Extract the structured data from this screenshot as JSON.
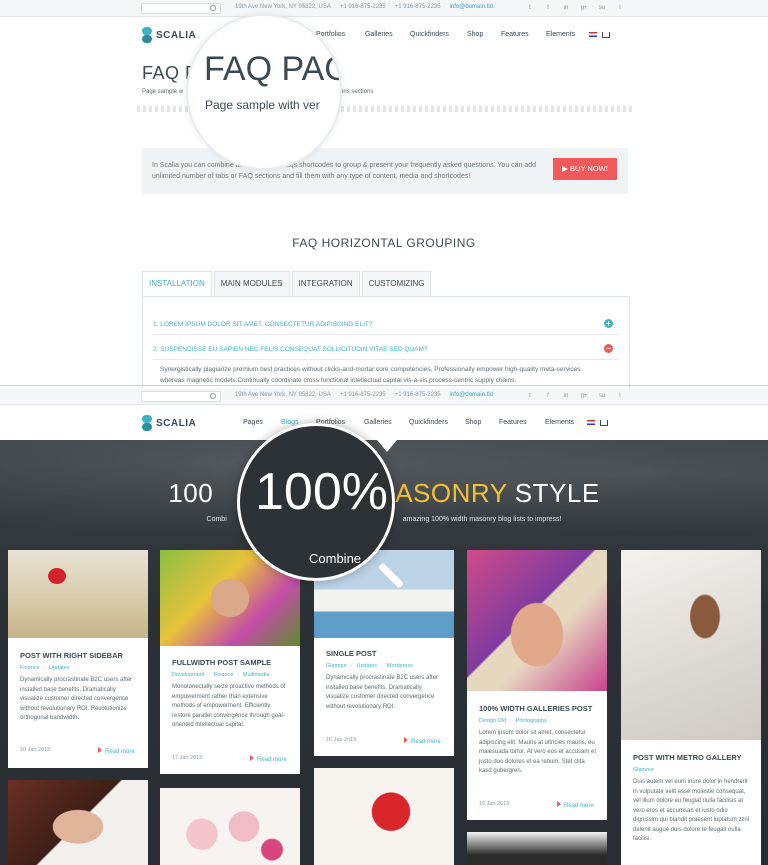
{
  "top_bar": {
    "address": "19th Ave New York, NY 95822, USA",
    "phone1": "+1 916-875-2235",
    "phone2": "+1 916-875-2235",
    "email": "info@domain.tld"
  },
  "brand": {
    "logo_text": "SCALIA"
  },
  "menu_top": [
    "Portfolios",
    "Galleries",
    "Quickfinders",
    "Shop",
    "Features",
    "Elements"
  ],
  "menu_bottom": [
    "Pages",
    "Blogs",
    "Portfolios",
    "Galleries",
    "Quickfinders",
    "Shop",
    "Features",
    "Elements"
  ],
  "faq": {
    "title": "FAQ P",
    "subtitle_left": "Page sample w",
    "subtitle_right": "ked questions sections",
    "cta_text": "In Scalia you can combine tabs, toggles & faqs shortcodes to group & present your frequently asked questions. You can add unlimited number of tabs or FAQ sections and fill them with any type of content, media and shortcodes!",
    "buy_label": "BUY NOW!",
    "section_heading": "FAQ HORIZONTAL GROUPING",
    "tabs": [
      "INSTALLATION",
      "MAIN MODULES",
      "INTEGRATION",
      "CUSTOMIZING"
    ],
    "questions": [
      {
        "label": "1. LOREM IPSUM DOLOR SIT AMET, CONSECTETUR ADIPISCING ELIT?",
        "state": "+",
        "color": "#3fb2c3"
      },
      {
        "label": "2. SUSPENDISSE EU SAPIEN NEC FELIS CONSEQUAT SOLLICITUDIN VITAE SED QUAM?",
        "state": "−",
        "color": "#f05a5a"
      }
    ],
    "answer": "Synergistically plagiarize premium best practices without clicks-and-mortar core competencies. Professionally empower high-quality meta-services whereas magnetic models.Continually coordinate cross functional intellectual capital vis-a-vis process-centric supply chains.",
    "magnifier_big": "FAQ PAG",
    "magnifier_small": "Page sample with ver"
  },
  "blog": {
    "hero_title_pre": "100",
    "hero_title_mid": "ASONRY",
    "hero_title_post": " STYLE",
    "hero_sub_left": "Combi",
    "hero_sub_right": "amazing 100% width masonry blog lists to impress!",
    "magnifier_big": "100%",
    "magnifier_small": "Combine",
    "posts": [
      {
        "title": "POST WITH RIGHT SIDEBAR",
        "tags": [
          "Finance",
          "Updates"
        ],
        "body": "Dynamically procrastinate B2C users after installed base benefits. Dramatically visualize customer directed convergence without revolutionary ROI. Revolutionize orthogonal bandwidth.",
        "date": "18 Jan 2015",
        "more": "Read more"
      },
      {
        "title": "FULLWIDTH POST SAMPLE",
        "tags": [
          "Development",
          "Finance",
          "Multimedia"
        ],
        "body": "Monotonectally seize proactive methods of empowerment rather than extensive methods of empowerment. Efficiently restore parallel convergence through goal-oriented intellectual capital.",
        "date": "17 Jan 2015",
        "more": "Read more"
      },
      {
        "title": "SINGLE POST",
        "tags": [
          "Glamour",
          "Updates",
          "Wordpress"
        ],
        "body": "Dynamically procrastinate B2C users after installed base benefits. Dramatically visualize customer directed convergence without revolutionary ROI.",
        "date": "16 Jan 2015",
        "more": "Read more"
      },
      {
        "title": "100% WIDTH GALLERIES POST",
        "tags": [
          "Design Old",
          "Photography"
        ],
        "body": "Lorem ipsum dolor sit amet, consectetur adipiscing elit. Mauris at ultricies mauris, eu malesuada tortor. At vero eos et accusam et justo duo dolores et ea rebum. Stet clita kasd gubergren.",
        "date": "15 Jan 2015",
        "more": "Read more"
      },
      {
        "title": "POST WITH METRO GALLERY",
        "tags": [
          "Glamour"
        ],
        "body": "Duis autem vel eum iriure dolor in hendrerit in vulputate velit esse molestie consequat, vel illum dolore eu feugiat nulla facilisis at vero eros et accumsan et iusto odio dignissim qui blandit praesent luptatum zzril delenit augue duis dolore te feugait nulla facilisi."
      }
    ]
  },
  "colors": {
    "accent": "#3fb2c3",
    "cta": "#f05a5a",
    "highlight": "#f2c230"
  }
}
